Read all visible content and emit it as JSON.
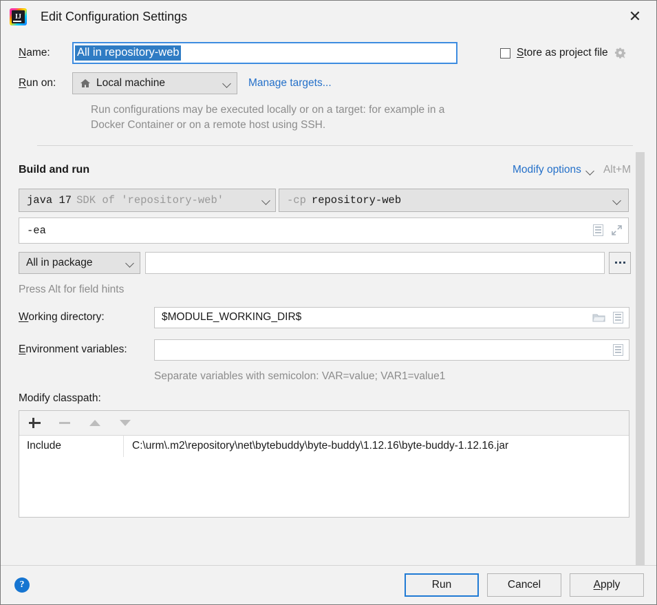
{
  "window": {
    "title": "Edit Configuration Settings",
    "app_icon": "intellij-idea-logo",
    "close_icon": "✕"
  },
  "top_form": {
    "name_label_mnemonic": "N",
    "name_label_rest": "ame:",
    "name_value": "All in repository-web",
    "store_checkbox": {
      "checked": false,
      "label_mnemonic": "S",
      "label_rest": "tore as project file",
      "gear_icon": "gear-icon"
    },
    "run_on_label_mnemonic": "R",
    "run_on_label_rest": "un on:",
    "run_on_value": "Local machine",
    "run_on_icon": "home-icon",
    "manage_targets_link": "Manage targets...",
    "help_text": "Run configurations may be executed locally or on a target: for example in a Docker Container or on a remote host using SSH."
  },
  "build_and_run": {
    "section_title": "Build and run",
    "modify_options_link": "Modify options",
    "modify_options_shortcut": "Alt+M",
    "jdk": {
      "primary": "java 17",
      "secondary": "SDK of 'repository-web'"
    },
    "classpath": {
      "flag": "-cp",
      "module": "repository-web"
    },
    "vm_options_value": "-ea",
    "vm_options_icons": [
      "document-icon",
      "expand-icon"
    ],
    "scope_combo_value": "All in package",
    "scope_input_value": "",
    "browse_button_label": "...",
    "alt_hint": "Press Alt for field hints",
    "working_directory": {
      "label_mnemonic": "W",
      "label_rest": "orking directory:",
      "value": "$MODULE_WORKING_DIR$",
      "icons": [
        "folder-icon",
        "document-icon"
      ]
    },
    "environment_variables": {
      "label_mnemonic": "E",
      "label_rest": "nvironment variables:",
      "value": "",
      "icons": [
        "document-icon"
      ],
      "hint": "Separate variables with semicolon: VAR=value; VAR1=value1"
    },
    "modify_classpath": {
      "title": "Modify classpath:",
      "toolbar": [
        {
          "name": "add-button",
          "icon": "plus-icon",
          "enabled": true
        },
        {
          "name": "remove-button",
          "icon": "minus-icon",
          "enabled": false
        },
        {
          "name": "move-up-button",
          "icon": "triangle-up-icon",
          "enabled": false
        },
        {
          "name": "move-down-button",
          "icon": "triangle-down-icon",
          "enabled": false
        }
      ],
      "rows": [
        {
          "type": "Include",
          "path": "C:\\urm\\.m2\\repository\\net\\bytebuddy\\byte-buddy\\1.12.16\\byte-buddy-1.12.16.jar"
        }
      ]
    }
  },
  "footer": {
    "help_icon": "?",
    "run_button": "Run",
    "cancel_button": "Cancel",
    "apply_button_mnemonic": "A",
    "apply_button_rest": "pply"
  },
  "colors": {
    "accent_blue": "#1f7ad4",
    "link_blue": "#2470c9",
    "selection_blue": "#2f7cc4",
    "dialog_bg": "#f2f2f2",
    "hint_gray": "#8c8c8c"
  }
}
